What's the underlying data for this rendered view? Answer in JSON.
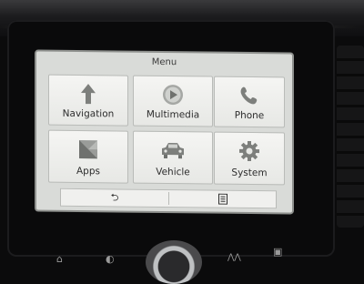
{
  "screen": {
    "title": "Menu"
  },
  "tiles": [
    {
      "label": "Navigation",
      "icon": "navigation-arrow-icon"
    },
    {
      "label": "Multimedia",
      "icon": "play-icon"
    },
    {
      "label": "Phone",
      "icon": "phone-icon"
    },
    {
      "label": "Apps",
      "icon": "apps-icon"
    },
    {
      "label": "Vehicle",
      "icon": "car-icon"
    },
    {
      "label": "System",
      "icon": "gear-icon"
    }
  ],
  "bottom_bar": {
    "back_glyph": "⮌",
    "list_icon": "list-icon"
  },
  "hardware_buttons": [
    {
      "icon": "home-icon",
      "glyph": "⌂"
    },
    {
      "icon": "display-icon",
      "glyph": "◐"
    },
    {
      "icon": "assist-icon",
      "glyph": "⋀⋀"
    },
    {
      "icon": "phone-hw-icon",
      "glyph": "▣"
    }
  ]
}
